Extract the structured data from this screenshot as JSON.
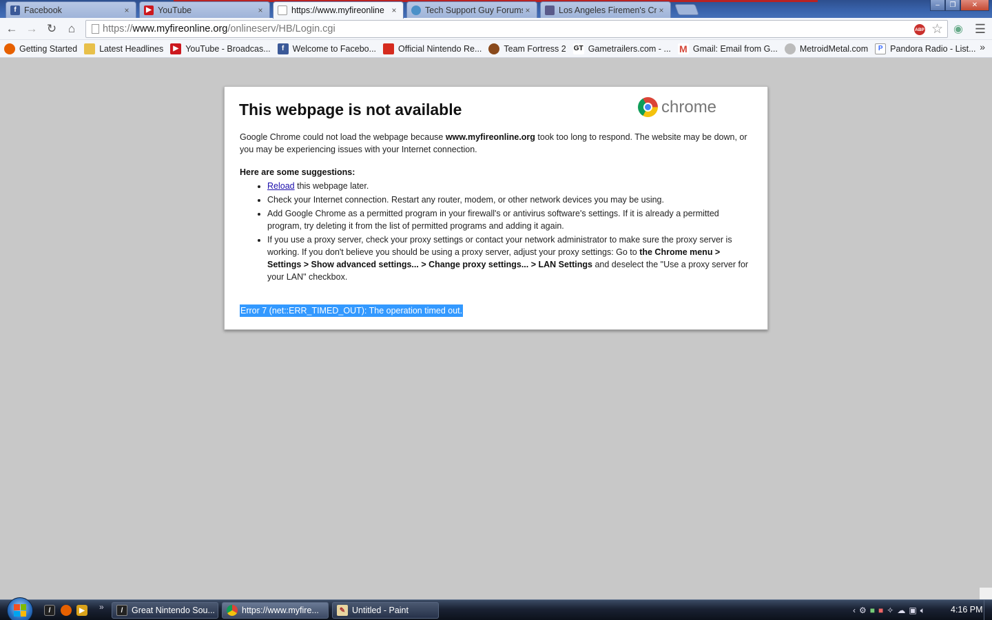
{
  "window": {
    "tabs": [
      {
        "label": "Facebook",
        "icon": "facebook-icon",
        "close": "×",
        "active": false
      },
      {
        "label": "YouTube",
        "icon": "youtube-icon",
        "close": "×",
        "active": false
      },
      {
        "label": "https://www.myfireonline",
        "icon": "page-icon",
        "close": "×",
        "active": true
      },
      {
        "label": "Tech Support Guy Forums",
        "icon": "globe-icon",
        "close": "×",
        "active": false
      },
      {
        "label": "Los Angeles Firemen's Cre",
        "icon": "site-icon",
        "close": "×",
        "active": false
      }
    ],
    "minimize": "–",
    "maximize": "❐",
    "close": "✕"
  },
  "toolbar": {
    "url_scheme": "https://",
    "url_host": "www.myfireonline.org",
    "url_path": "/onlineserv/HB/Login.cgi",
    "abp_badge": "ABP"
  },
  "bookmarks": [
    {
      "label": "Getting Started",
      "icon": "firefox-icon",
      "color": "#e66000"
    },
    {
      "label": "Latest Headlines",
      "icon": "folder-icon",
      "color": "#e8c04a"
    },
    {
      "label": "YouTube - Broadcas...",
      "icon": "youtube-icon",
      "color": "#cc181e"
    },
    {
      "label": "Welcome to Facebo...",
      "icon": "facebook-icon",
      "color": "#3b5998"
    },
    {
      "label": "Official Nintendo Re...",
      "icon": "mario-icon",
      "color": "#d52b1e"
    },
    {
      "label": "Team Fortress 2",
      "icon": "tf2-icon",
      "color": "#8a4a1c"
    },
    {
      "label": "Gametrailers.com - ...",
      "icon": "gt-icon",
      "color": "#111111"
    },
    {
      "label": "Gmail: Email from G...",
      "icon": "gmail-icon",
      "color": "#d44638"
    },
    {
      "label": "MetroidMetal.com",
      "icon": "gear-icon",
      "color": "#999999"
    },
    {
      "label": "Pandora Radio - List...",
      "icon": "pandora-icon",
      "color": "#3668ff"
    }
  ],
  "bookmarks_more": "»",
  "error_page": {
    "title": "This webpage is not available",
    "logo_word": "chrome",
    "intro_1": "Google Chrome could not load the webpage because ",
    "intro_host": "www.myfireonline.org",
    "intro_2": " took too long to respond. The website may be down, or you may be experiencing issues with your Internet connection.",
    "suggestions_heading": "Here are some suggestions:",
    "s1_link": "Reload",
    "s1_rest": " this webpage later.",
    "s2": "Check your Internet connection. Restart any router, modem, or other network devices you may be using.",
    "s3": "Add Google Chrome as a permitted program in your firewall's or antivirus software's settings. If it is already a permitted program, try deleting it from the list of permitted programs and adding it again.",
    "s4_a": "If you use a proxy server, check your proxy settings or contact your network administrator to make sure the proxy server is working. If you don't believe you should be using a proxy server, adjust your proxy settings: Go to ",
    "s4_bold": "the Chrome menu > Settings > Show advanced settings... > Change proxy settings... > LAN Settings",
    "s4_b": " and deselect the \"Use a proxy server for your LAN\" checkbox.",
    "error_code": "Error 7 (net::ERR_TIMED_OUT): The operation timed out."
  },
  "taskbar": {
    "quicklaunch_more": "»",
    "tasks": [
      {
        "label": "Great Nintendo Sou...",
        "icon": "foobar-icon",
        "active": false
      },
      {
        "label": "https://www.myfire...",
        "icon": "chrome-icon",
        "active": true
      },
      {
        "label": "Untitled - Paint",
        "icon": "paint-icon",
        "active": false
      }
    ],
    "tray_expand": "‹",
    "clock": "4:16 PM"
  }
}
